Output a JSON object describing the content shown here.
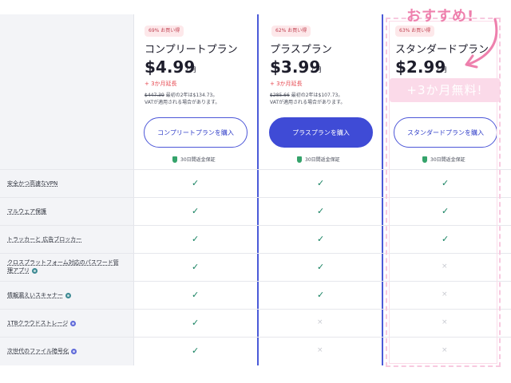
{
  "plans": [
    {
      "badge": "69% お買い得",
      "name": "コンプリートプラン",
      "price": "$4.99",
      "per": "/ 月",
      "extension": "+ 3か月延長",
      "renew_old": "$447.39",
      "renew_rest": "最初の2年は$134.73。",
      "vat": "VATが適用される場合があります。",
      "button": "コンプリートプランを購入",
      "guarantee": "30日間返金保証"
    },
    {
      "badge": "62% お買い得",
      "name": "プラスプラン",
      "price": "$3.99",
      "per": "/ 月",
      "extension": "+ 3か月延長",
      "renew_old": "$285.66",
      "renew_rest": "最初の2年は$107.73。",
      "vat": "VATが適用される場合があります。",
      "button": "プラスプランを購入",
      "guarantee": "30日間返金保証"
    },
    {
      "badge": "63% お買い得",
      "name": "スタンダードプラン",
      "price": "$2.99",
      "per": "/ 月",
      "button": "スタンダードプランを購入",
      "guarantee": "30日間返金保証"
    }
  ],
  "features": [
    {
      "label": "安全かつ高速なVPN",
      "info": "",
      "marks": [
        true,
        true,
        true
      ]
    },
    {
      "label": "マルウェア保護",
      "info": "",
      "marks": [
        true,
        true,
        true
      ]
    },
    {
      "label": "トラッカーと 広告ブロッカー",
      "info": "",
      "marks": [
        true,
        true,
        true
      ]
    },
    {
      "label": "クロスプラットフォーム対応のパスワード管理アプリ",
      "info": "teal",
      "marks": [
        true,
        true,
        false
      ]
    },
    {
      "label": "情報漏えいスキャナー",
      "info": "teal",
      "marks": [
        true,
        true,
        false
      ]
    },
    {
      "label": "1TBクラウドストレージ",
      "info": "purple",
      "marks": [
        true,
        false,
        false
      ]
    },
    {
      "label": "次世代のファイル暗号化",
      "info": "purple",
      "marks": [
        true,
        false,
        false
      ]
    }
  ],
  "symbols": {
    "check": "✓",
    "cross": "×"
  },
  "annotation": {
    "recommend": "おすすめ!",
    "free_banner": "+3か月無料!"
  },
  "colors": {
    "accent": "#3f4bd6",
    "check": "#14805f",
    "extension": "#e6474f",
    "highlight": "#ee80ad"
  }
}
